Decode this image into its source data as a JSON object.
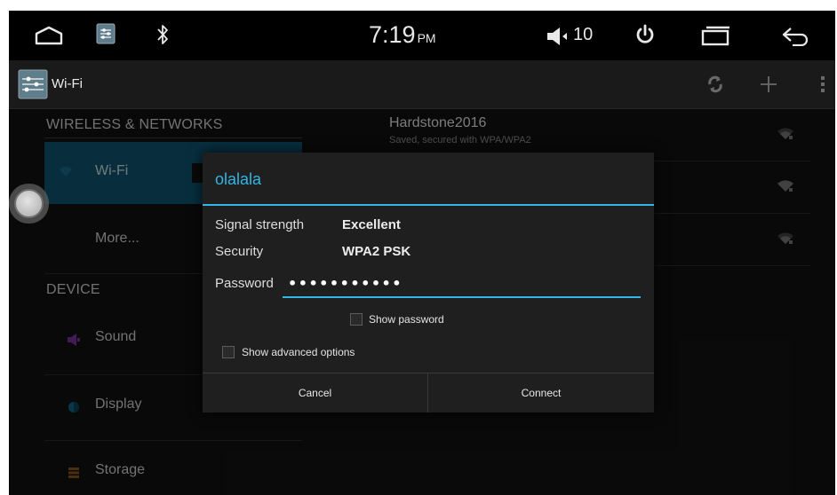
{
  "status_bar": {
    "time": "7:19",
    "ampm": "PM",
    "volume": "10"
  },
  "action_bar": {
    "title": "Wi-Fi"
  },
  "left_panel": {
    "section_wireless": "WIRELESS & NETWORKS",
    "wifi_label": "Wi-Fi",
    "more_label": "More...",
    "section_device": "DEVICE",
    "sound_label": "Sound",
    "display_label": "Display",
    "storage_label": "Storage"
  },
  "networks": [
    {
      "name": "Hardstone2016",
      "status": "Saved, secured with WPA/WPA2"
    }
  ],
  "dialog": {
    "title": "olalala",
    "signal_label": "Signal strength",
    "signal_value": "Excellent",
    "security_label": "Security",
    "security_value": "WPA2 PSK",
    "password_label": "Password",
    "password_value": "•••••••••••",
    "show_password_label": "Show password",
    "show_advanced_label": "Show advanced options",
    "cancel_label": "Cancel",
    "connect_label": "Connect"
  },
  "colors": {
    "accent": "#33b5e5",
    "selected_item_bg": "#0e4b64"
  }
}
